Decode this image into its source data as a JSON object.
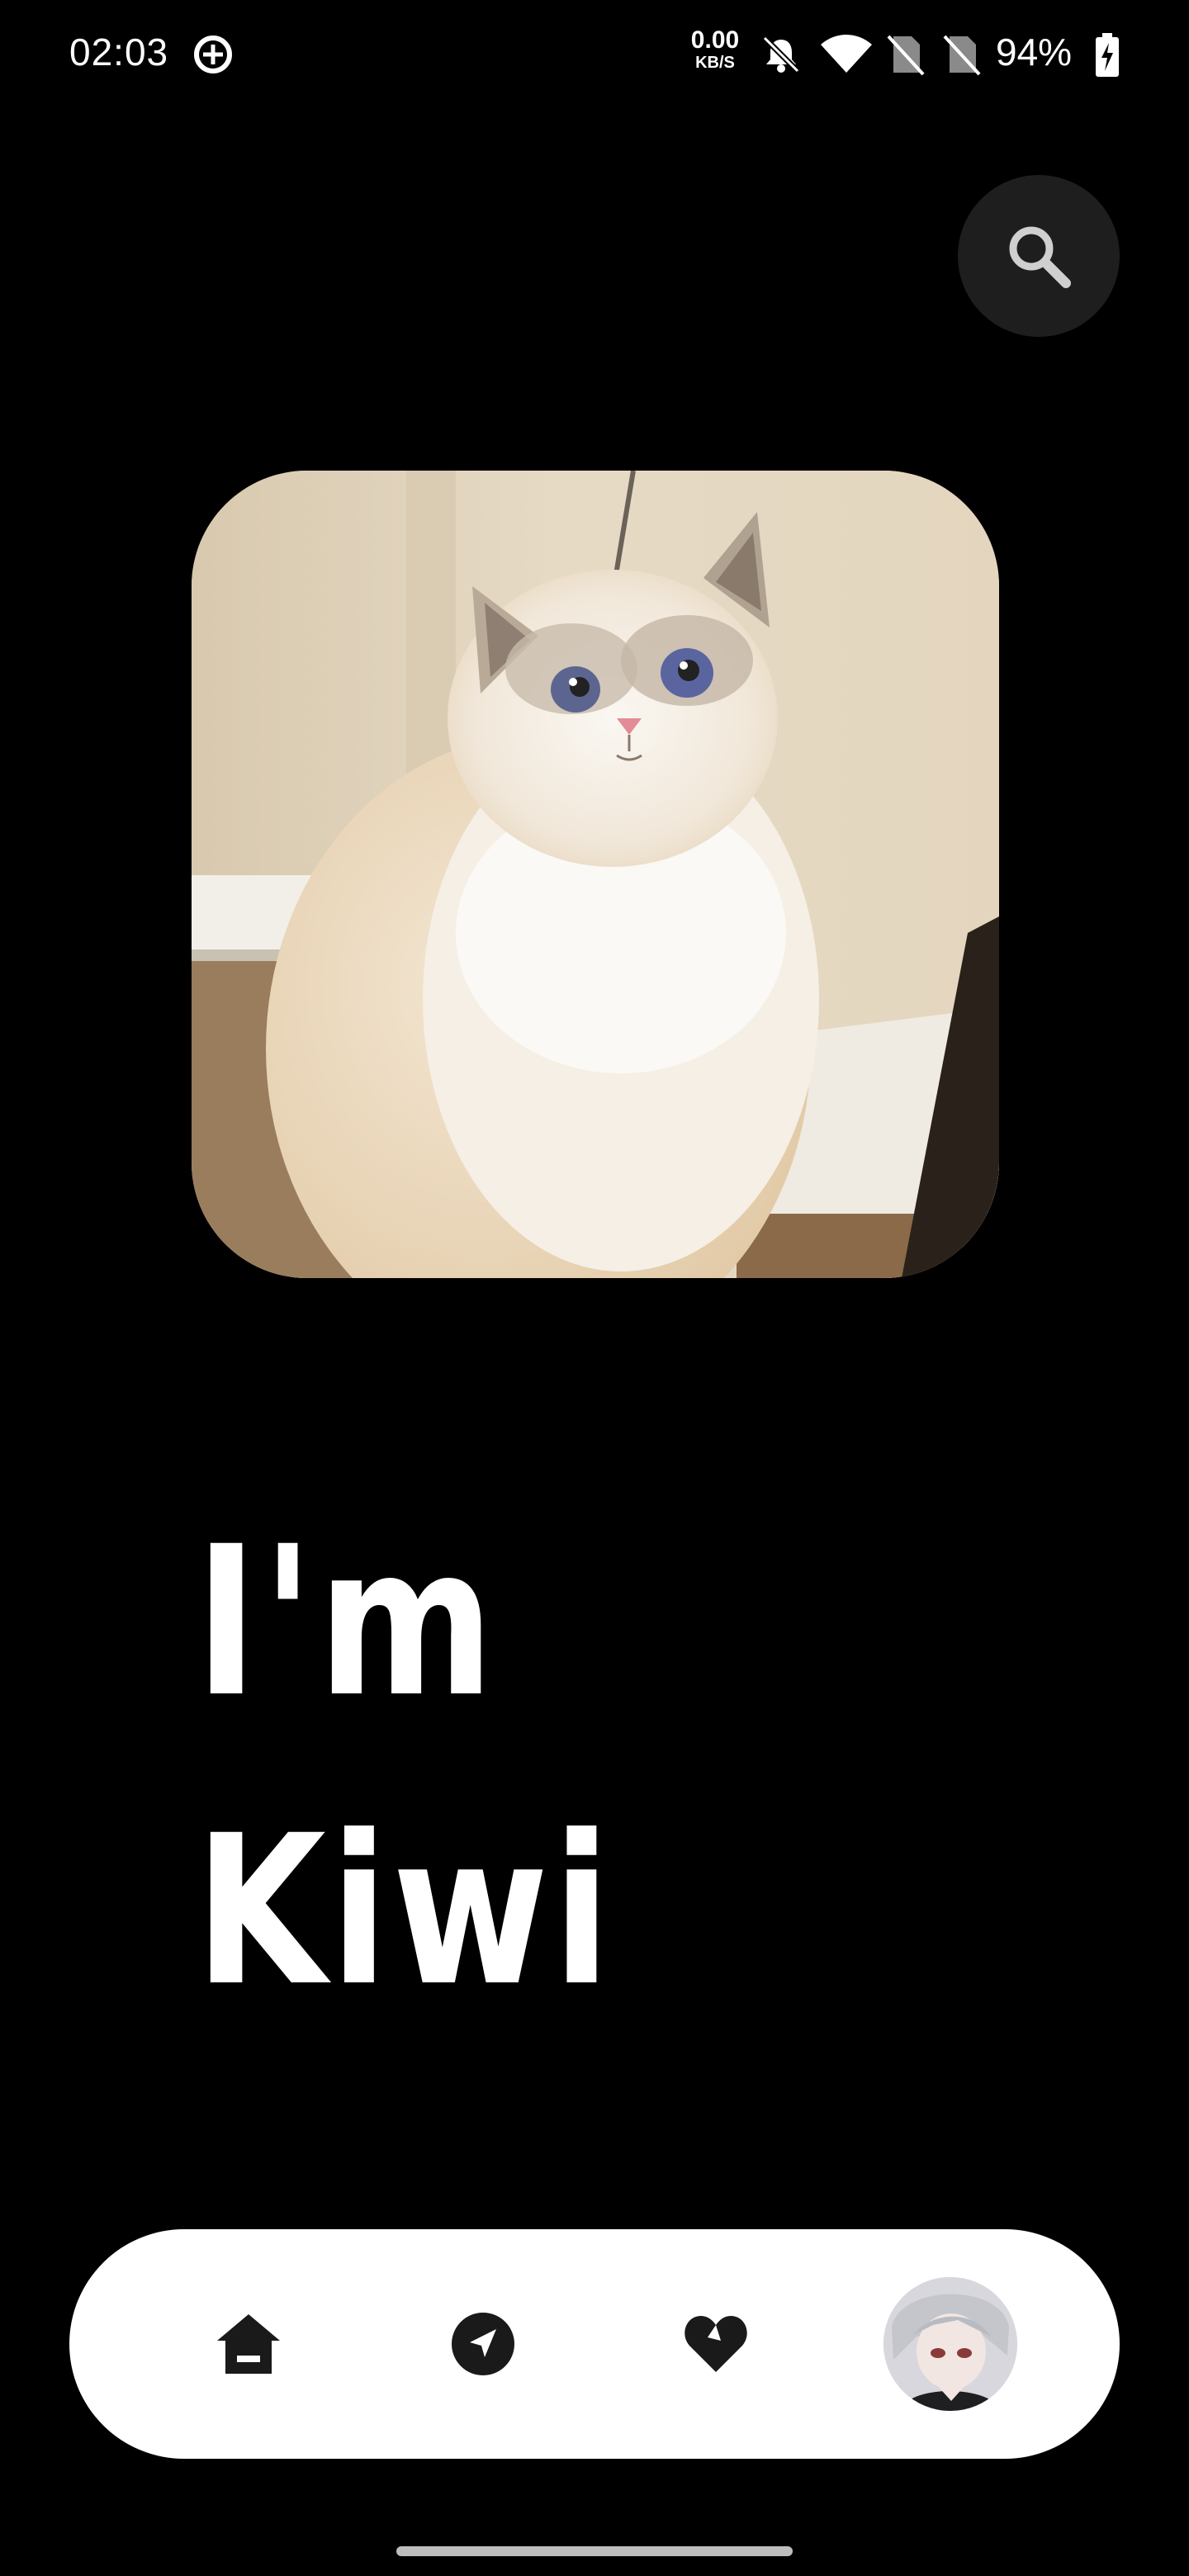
{
  "status_bar": {
    "time": "02:03",
    "net_speed_value": "0.00",
    "net_speed_unit": "KB/S",
    "battery_percent": "94%",
    "icons": [
      "data-saver-icon",
      "bell-off-icon",
      "wifi-icon",
      "no-sim-icon",
      "no-sim-icon",
      "battery-charging-icon"
    ]
  },
  "header": {
    "search_icon": "search-icon"
  },
  "hero": {
    "image": "cat-photo"
  },
  "title": {
    "line1": "I'm",
    "line2": "Kiwi"
  },
  "bottom_nav": {
    "items": [
      {
        "icon": "home-icon"
      },
      {
        "icon": "navigation-icon"
      },
      {
        "icon": "heart-icon"
      },
      {
        "icon": "profile-avatar"
      }
    ]
  },
  "colors": {
    "background": "#000000",
    "nav_background": "#ffffff",
    "nav_icon": "#1a1a1a",
    "search_button": "#1e1e1e"
  }
}
